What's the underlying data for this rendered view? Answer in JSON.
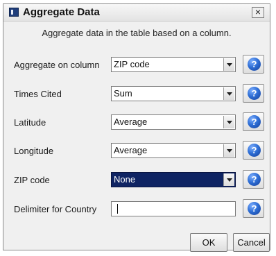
{
  "window": {
    "title": "Aggregate Data",
    "close_glyph": "×"
  },
  "subtitle": "Aggregate data in the table based on a column.",
  "rows": [
    {
      "label": "Aggregate on column",
      "value": "ZIP code"
    },
    {
      "label": "Times Cited",
      "value": "Sum"
    },
    {
      "label": "Latitude",
      "value": "Average"
    },
    {
      "label": "Longitude",
      "value": "Average"
    },
    {
      "label": "ZIP code",
      "value": "None",
      "selected": true
    }
  ],
  "delimiter": {
    "label": "Delimiter for Country",
    "value": ""
  },
  "help_glyph": "?",
  "buttons": {
    "ok": "OK",
    "cancel": "Cancel"
  },
  "colors": {
    "dialog_bg": "#f0f0f0",
    "selection_bg": "#0f2463",
    "help_icon_blue": "#2f6fd6"
  },
  "icons": {
    "title": "app-icon",
    "close": "close-icon",
    "dropdown": "chevron-down-icon",
    "help": "question-mark-icon"
  }
}
